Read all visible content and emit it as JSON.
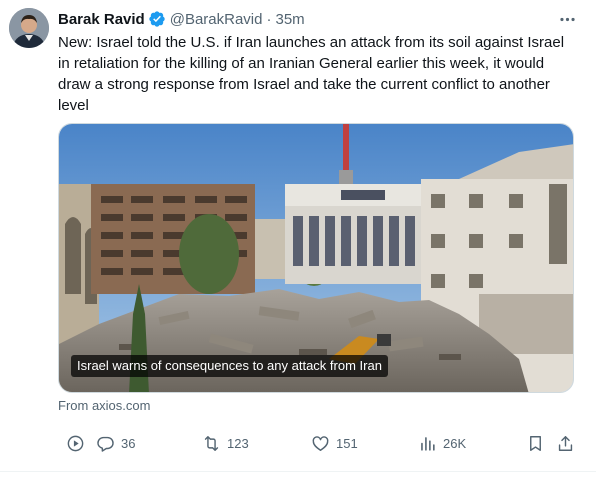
{
  "author": {
    "name": "Barak Ravid",
    "handle": "@BarakRavid",
    "separator": "·",
    "time": "35m"
  },
  "tweet_text": "New: Israel told the U.S. if Iran launches an attack from its soil against Israel in retaliation for the killing of an Iranian General earlier this week, it would draw a strong response from Israel and take the current conflict to another level",
  "media": {
    "caption": "Israel warns of consequences to any attack from Iran"
  },
  "source": "From axios.com",
  "actions": {
    "replies": "36",
    "reposts": "123",
    "likes": "151",
    "views": "26K"
  },
  "colors": {
    "verified": "#1d9bf0",
    "muted": "#536471",
    "text": "#0f1419"
  },
  "icons": [
    "verified-badge-icon",
    "more-icon",
    "play-icon",
    "reply-icon",
    "repost-icon",
    "like-icon",
    "views-icon",
    "bookmark-icon",
    "share-icon"
  ]
}
